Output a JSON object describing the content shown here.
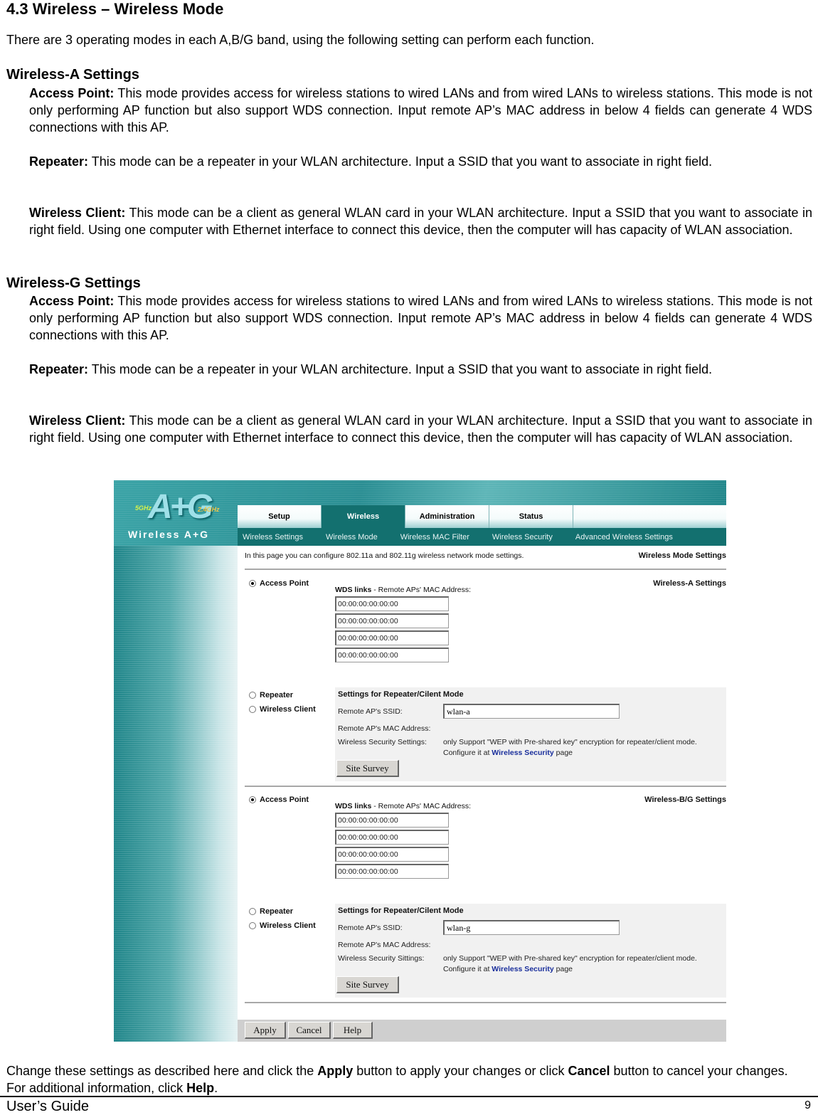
{
  "doc": {
    "heading": "4.3 Wireless – Wireless Mode",
    "intro": "There are 3 operating modes in each A,B/G band, using the following setting can perform each function.",
    "sections": [
      {
        "title": "Wireless-A Settings",
        "items": [
          {
            "term": "Access Point:",
            "text": " This mode provides access for wireless stations to wired LANs and from wired LANs to wireless stations. This mode is not only performing AP function but also support WDS connection. Input remote AP’s MAC address in below 4 fields can generate 4 WDS connections with this AP."
          },
          {
            "term": "Repeater:",
            "text": " This mode can be a repeater in your WLAN architecture. Input a SSID that you want to associate in right field."
          },
          {
            "term": "Wireless Client:",
            "text": " This mode can be a client as general WLAN card in your WLAN architecture. Input a SSID that you want to associate in right field. Using one computer with Ethernet interface to connect this device, then the computer will has capacity of WLAN association."
          }
        ]
      },
      {
        "title": "Wireless-G Settings",
        "items": [
          {
            "term": "Access Point:",
            "text": " This mode provides access for wireless stations to wired LANs and from wired LANs to wireless stations. This mode is not only performing AP function but also support WDS connection. Input remote AP’s MAC address in below 4 fields can generate 4 WDS connections with this AP."
          },
          {
            "term": "Repeater:",
            "text": " This mode can be a repeater in your WLAN architecture. Input a SSID that you want to associate in right field."
          },
          {
            "term": "Wireless Client:",
            "text": " This mode can be a client as general WLAN card in your WLAN architecture. Input a SSID that you want to associate in right field. Using one computer with Ethernet interface to connect this device, then the computer will has capacity of WLAN association."
          }
        ]
      }
    ],
    "closing": {
      "p1": "Change these settings as described here and click the ",
      "apply": "Apply",
      "p2": " button to apply your changes or click ",
      "cancel": "Cancel",
      "p3": " button to cancel your changes. For additional information, click ",
      "help": "Help",
      "p4": "."
    },
    "footer": {
      "left": "User’s Guide",
      "page": "9"
    }
  },
  "ui": {
    "logo": {
      "main": "A+G",
      "band_a": "5GHz",
      "band_g": "2.4GHz",
      "name": "Wireless A+G"
    },
    "tabs": [
      "Setup",
      "Wireless",
      "Administration",
      "Status"
    ],
    "active_tab": "Wireless",
    "subnav": [
      "Wireless Settings",
      "Wireless Mode",
      "Wireless MAC Filter",
      "Wireless Security",
      "Advanced Wireless Settings"
    ],
    "side_labels": {
      "page": "Wireless Mode Settings",
      "a": "Wireless-A Settings",
      "bg": "Wireless-B/G Settings"
    },
    "description": "In this page you can configure 802.11a and 802.11g wireless network mode settings.",
    "band_a": {
      "modes": {
        "ap": "Access Point",
        "repeater": "Repeater",
        "client": "Wireless Client"
      },
      "selected": "Access Point",
      "wds_title": "WDS links",
      "wds_suffix": " - Remote APs' MAC Address:",
      "wds_macs": [
        "00:00:00:00:00:00",
        "00:00:00:00:00:00",
        "00:00:00:00:00:00",
        "00:00:00:00:00:00"
      ],
      "rep": {
        "title": "Settings for Repeater/Cilent Mode",
        "ssid_label": "Remote AP's SSID:",
        "ssid_value": "wlan-a",
        "mac_label": "Remote AP's MAC Address:",
        "sec_label": "Wireless Security Settings:",
        "sec_note": "only Support \"WEP with Pre-shared key\" encryption for repeater/client mode.",
        "sec_cfg_pre": "Configure it at ",
        "sec_link": "Wireless Security",
        "sec_cfg_post": " page",
        "site_survey": "Site Survey"
      }
    },
    "band_g": {
      "modes": {
        "ap": "Access Point",
        "repeater": "Repeater",
        "client": "Wireless Client"
      },
      "selected": "Access Point",
      "wds_title": "WDS links",
      "wds_suffix": " - Remote APs' MAC Address:",
      "wds_macs": [
        "00:00:00:00:00:00",
        "00:00:00:00:00:00",
        "00:00:00:00:00:00",
        "00:00:00:00:00:00"
      ],
      "rep": {
        "title": "Settings for Repeater/Cilent Mode",
        "ssid_label": "Remote AP's SSID:",
        "ssid_value": "wlan-g",
        "mac_label": "Remote AP's MAC Address:",
        "sec_label": "Wireless Security Sittings:",
        "sec_note": "only Support \"WEP with Pre-shared key\" encryption for repeater/client mode.",
        "sec_cfg_pre": "Configure it at ",
        "sec_link": "Wireless Security",
        "sec_cfg_post": " page",
        "site_survey": "Site Survey"
      }
    },
    "buttons": {
      "apply": "Apply",
      "cancel": "Cancel",
      "help": "Help"
    }
  }
}
